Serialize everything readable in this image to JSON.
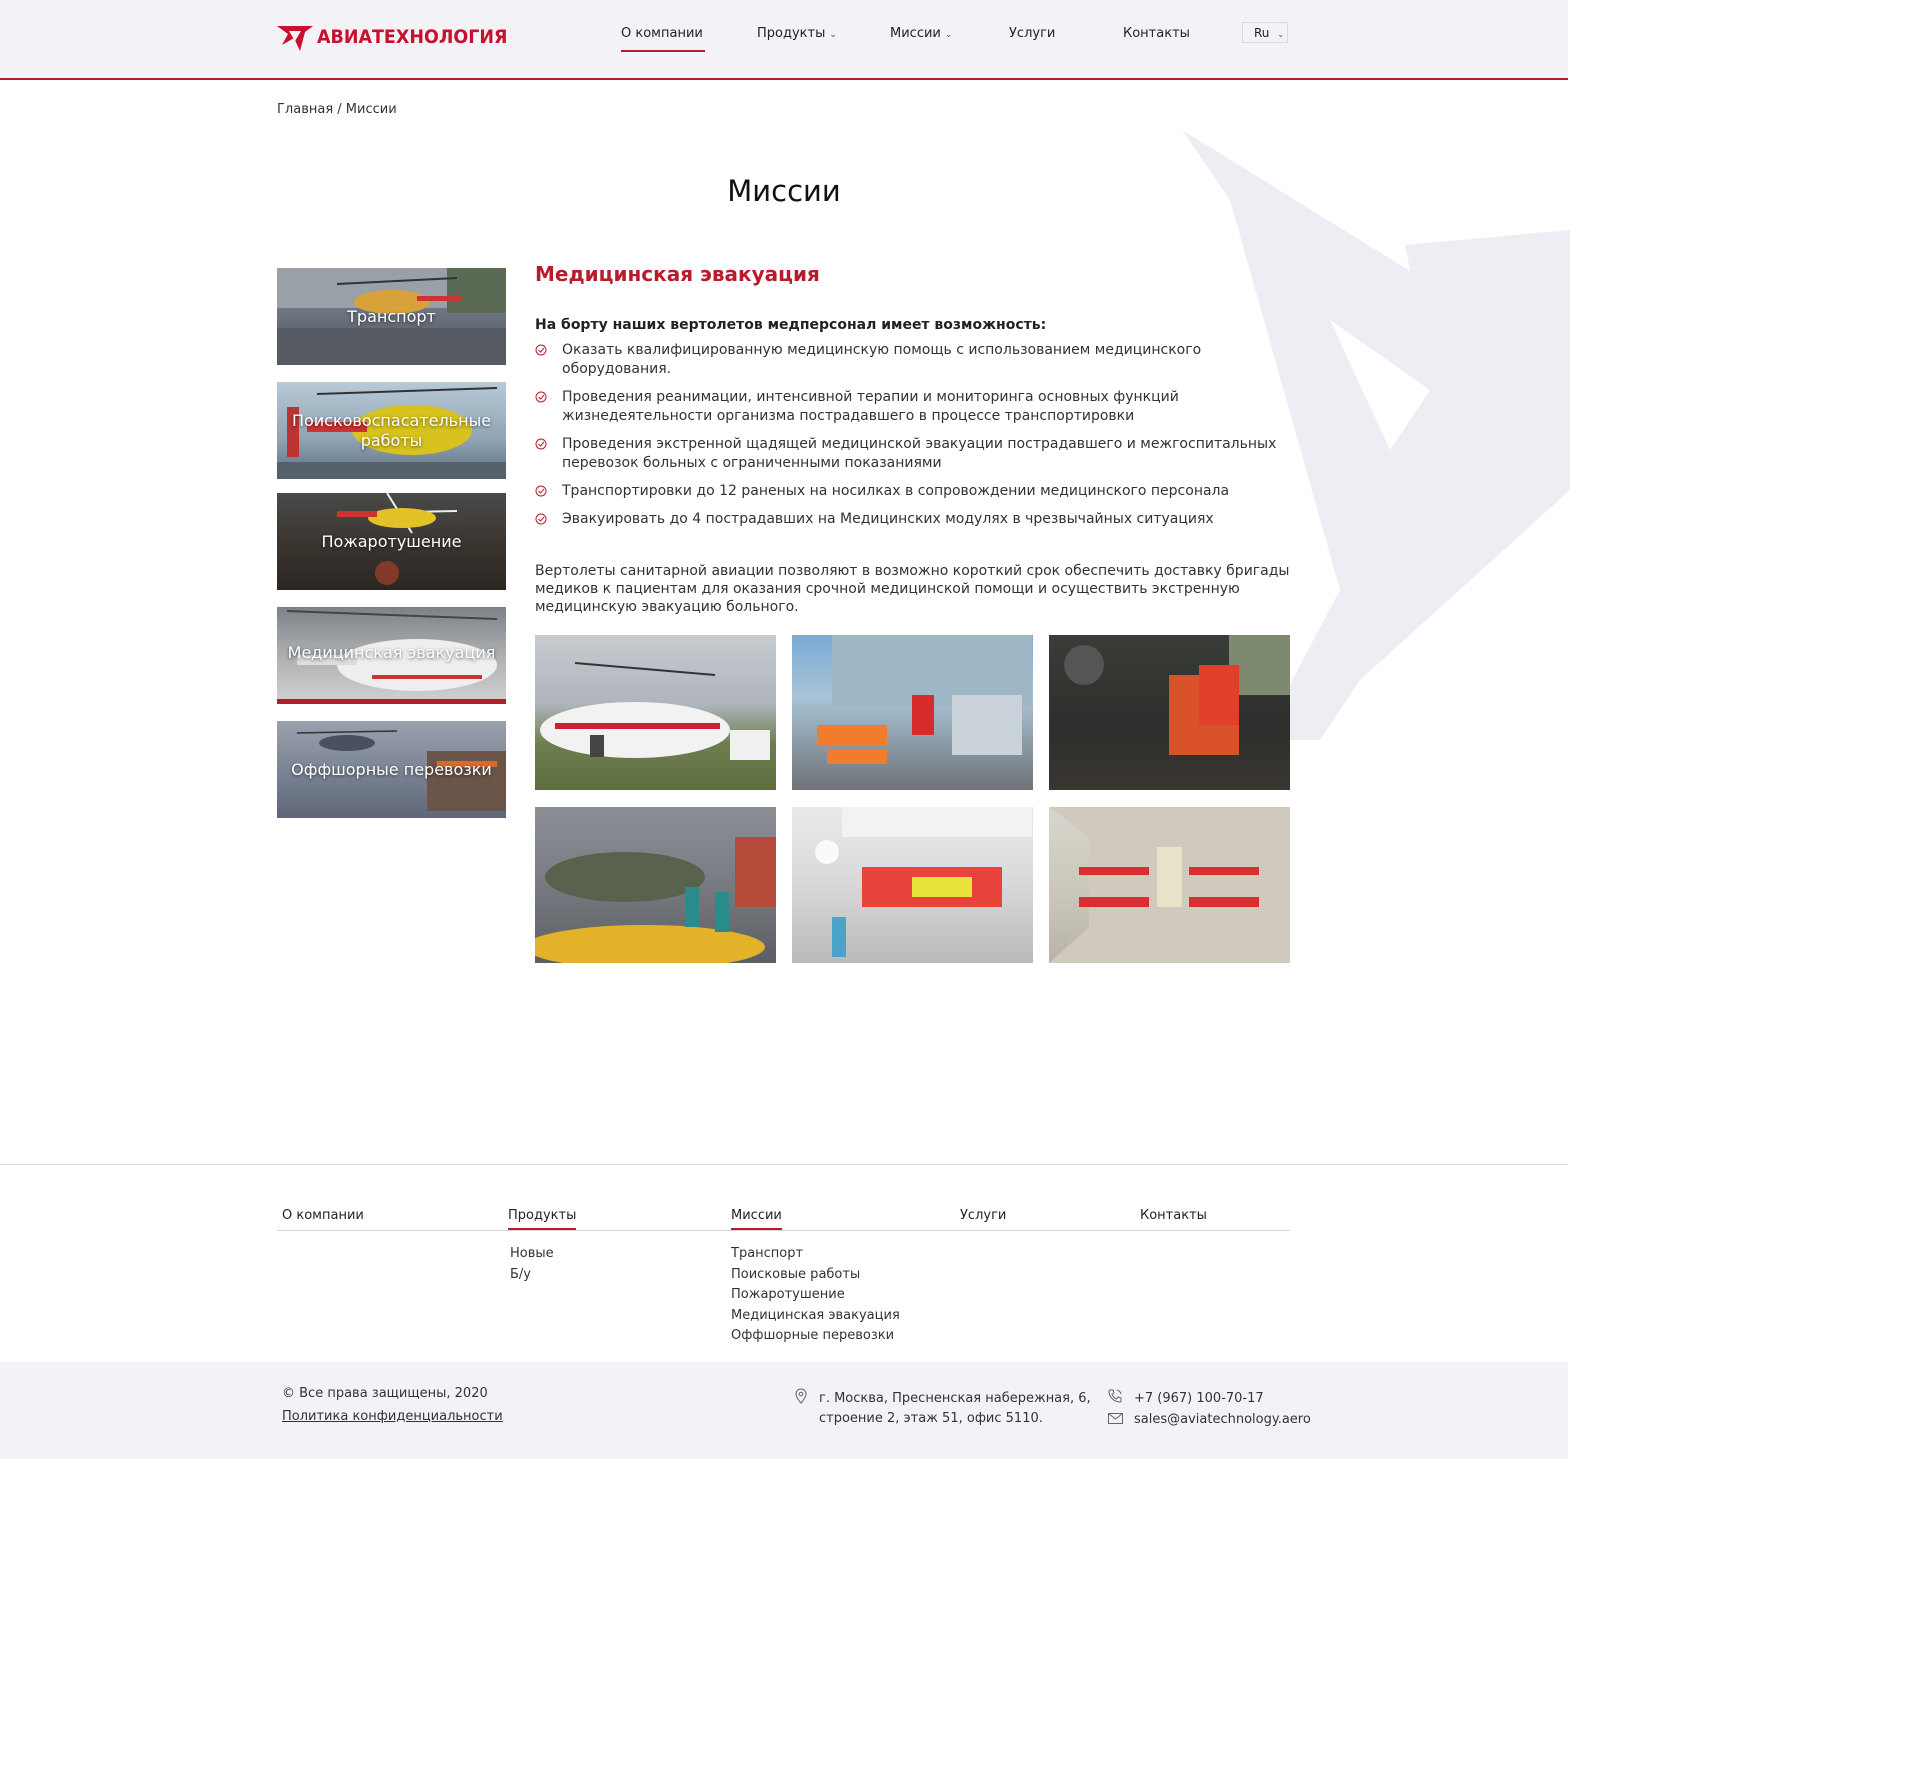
{
  "header": {
    "logo_text": "АВИАТЕХНОЛОГИЯ",
    "nav": [
      {
        "label": "О компании",
        "active": true,
        "dropdown": false
      },
      {
        "label": "Продукты",
        "active": false,
        "dropdown": true
      },
      {
        "label": "Миссии",
        "active": false,
        "dropdown": true
      },
      {
        "label": "Услуги",
        "active": false,
        "dropdown": false
      },
      {
        "label": "Контакты",
        "active": false,
        "dropdown": false
      }
    ],
    "language": "Ru"
  },
  "breadcrumb": "Главная / Миссии",
  "page_title": "Миссии",
  "sidebar": {
    "items": [
      {
        "label": "Транспорт"
      },
      {
        "label": "Поисковоспасательные работы"
      },
      {
        "label": "Пожаротушение"
      },
      {
        "label": "Медицинская эвакуация",
        "active": true
      },
      {
        "label": "Оффшорные перевозки"
      }
    ]
  },
  "content": {
    "title": "Медицинская эвакуация",
    "intro": "На борту наших вертолетов медперсонал имеет возможность:",
    "features": [
      "Оказать квалифицированную медицинскую помощь с использованием медицинского оборудования.",
      "Проведения реанимации, интенсивной терапии и мониторинга основных функций жизнедеятельности организма пострадавшего в процессе транспортировки",
      "Проведения экстренной щадящей медицинской эвакуации пострадавшего и межгоспитальных перевозок больных с ограниченными показаниями",
      "Транспортировки до 12 раненых на носилках в сопровождении медицинского персонала",
      "Эвакуировать до 4 пострадавших на Медицинских модулях в чрезвычайных ситуациях"
    ],
    "paragraph": "Вертолеты санитарной авиации позволяют в возможно короткий срок  обеспечить доставку бригады медиков к пациентам для оказания срочной медицинской помощи и осуществить экстренную медицинскую эвакуацию больного."
  },
  "footer": {
    "nav": [
      {
        "label": "О компании"
      },
      {
        "label": "Продукты",
        "active": true
      },
      {
        "label": "Миссии",
        "active": true
      },
      {
        "label": "Услуги"
      },
      {
        "label": "Контакты"
      }
    ],
    "products": [
      "Новые",
      "Б/у"
    ],
    "missions": [
      "Транспорт",
      "Поисковые работы",
      "Пожаротушение",
      "Медицинская эвакуация",
      "Оффшорные перевозки"
    ],
    "copyright": "© Все права защищены, 2020",
    "privacy": "Политика конфиденциальности",
    "address_line1": "г. Москва, Пресненская набережная, 6,",
    "address_line2": "строение 2, этаж 51, офис 5110.",
    "phone": "+7 (967) 100-70-17",
    "email": "sales@aviatechnology.aero"
  },
  "colors": {
    "accent": "#b71c2b",
    "header_bg": "#f3f2f6",
    "star_bg": "#eeedf3"
  }
}
